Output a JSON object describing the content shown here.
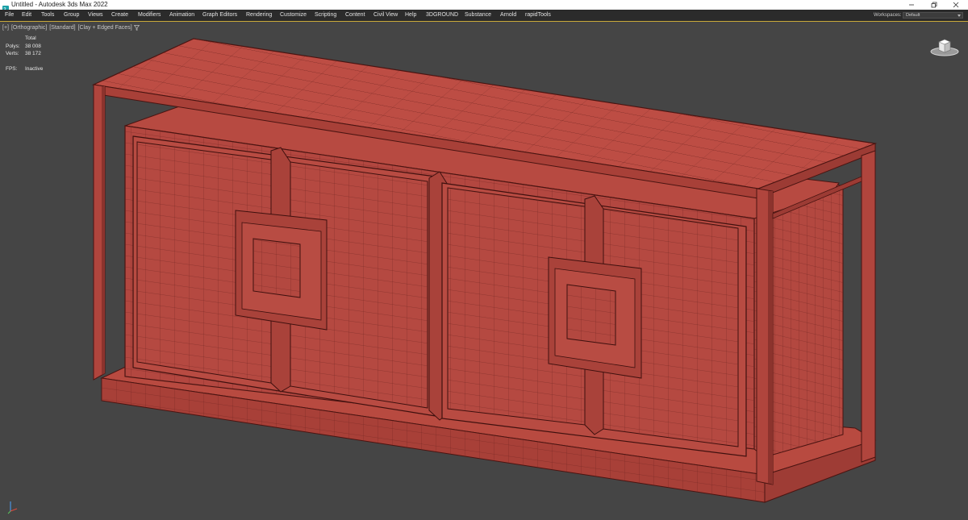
{
  "window": {
    "title": "Untitled - Autodesk 3ds Max 2022",
    "app_icon": "3ds-max-icon",
    "controls": [
      "minimize-icon",
      "restore-icon",
      "close-icon"
    ]
  },
  "menubar": {
    "items": [
      "File",
      "Edit",
      "Tools",
      "Group",
      "Views",
      "Create",
      "Modifiers",
      "Animation",
      "Graph Editors",
      "Rendering",
      "Customize",
      "Scripting",
      "Content",
      "Civil View",
      "Help",
      "3DGROUND",
      "Substance",
      "Arnold",
      "rapidTools"
    ],
    "workspaces_label": "Workspaces:",
    "workspaces_value": "Default"
  },
  "viewport": {
    "label_parts": [
      "[+]",
      "[Orthographic]",
      "[Standard]",
      "[Clay + Edged Faces]"
    ],
    "filter_icon": "filter-icon",
    "stats": {
      "header": "Total",
      "polys_label": "Polys:",
      "polys_value": "38 008",
      "verts_label": "Verts:",
      "verts_value": "38 172",
      "fps_label": "FPS:",
      "fps_value": "Inactive"
    },
    "object": "sideboard-model",
    "object_color": "#b84a40",
    "wire_color": "#5a1a17",
    "viewcube_icon": "viewcube-home-icon",
    "axis_icon": "axis-tripod-icon"
  }
}
